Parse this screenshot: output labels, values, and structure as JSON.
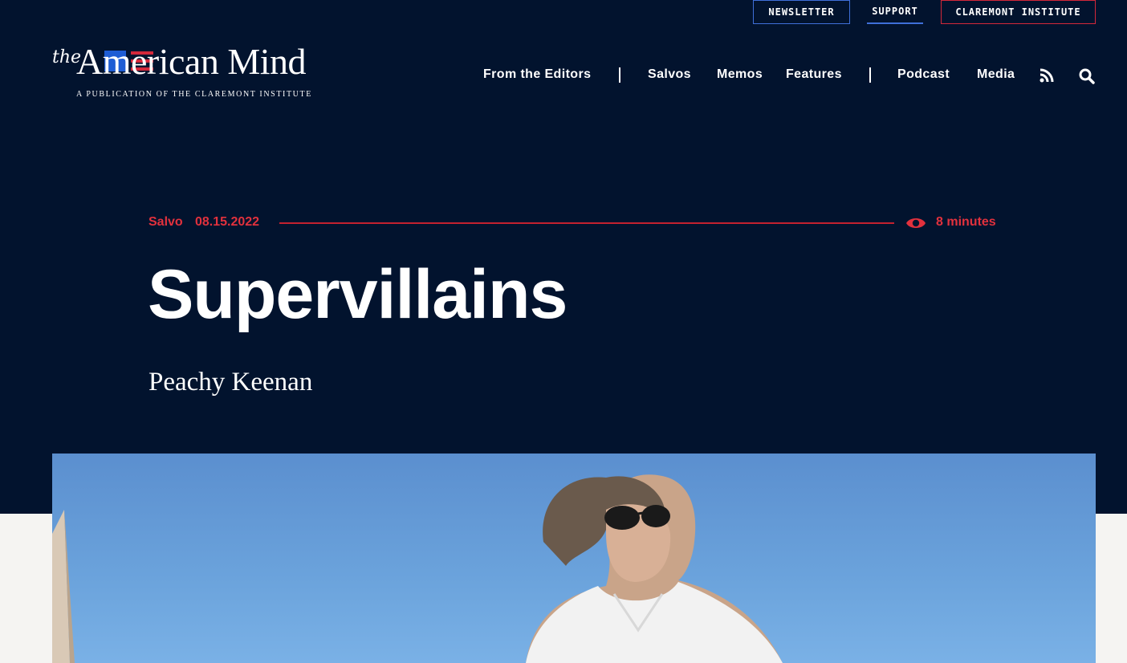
{
  "utility_links": {
    "newsletter": "NEWSLETTER",
    "support": "SUPPORT",
    "claremont": "CLAREMONT INSTITUTE"
  },
  "logo": {
    "the": "the",
    "name": "American Mind",
    "subtitle": "A PUBLICATION OF THE CLAREMONT INSTITUTE"
  },
  "nav": {
    "from_editors": "From the Editors",
    "salvos": "Salvos",
    "memos": "Memos",
    "features": "Features",
    "podcast": "Podcast",
    "media": "Media",
    "icons": [
      "rss-icon",
      "search-icon"
    ]
  },
  "article": {
    "category": "Salvo",
    "date": "08.15.2022",
    "read_time": "8 minutes",
    "title": "Supervillains",
    "author": "Peachy Keenan"
  },
  "colors": {
    "navy": "#02132e",
    "accent_red": "#e2313d",
    "accent_blue": "#3f6fd9"
  }
}
